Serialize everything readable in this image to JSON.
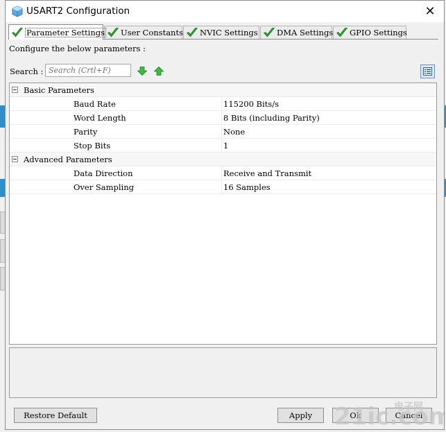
{
  "window": {
    "title": "USART2 Configuration",
    "close_glyph": "✕",
    "icon": "cube-icon"
  },
  "tabs": [
    {
      "label": "Parameter Settings",
      "icon": "green-check-icon",
      "active": true
    },
    {
      "label": "User Constants",
      "icon": "green-check-icon",
      "active": false
    },
    {
      "label": "NVIC Settings",
      "icon": "green-check-icon",
      "active": false
    },
    {
      "label": "DMA Settings",
      "icon": "green-check-icon",
      "active": false
    },
    {
      "label": "GPIO Settings",
      "icon": "green-check-icon",
      "active": false
    }
  ],
  "panel": {
    "description": "Configure the below parameters :",
    "search_label": "Search :",
    "search_placeholder": "Search (Crtl+F)",
    "down_arrow_icon": "green-down-arrow-icon",
    "up_arrow_icon": "green-up-arrow-icon",
    "view_icon": "list-view-icon"
  },
  "groups": [
    {
      "label": "Basic Parameters",
      "params": [
        {
          "name": "Baud Rate",
          "value": "115200 Bits/s"
        },
        {
          "name": "Word Length",
          "value": "8 Bits (including Parity)"
        },
        {
          "name": "Parity",
          "value": "None"
        },
        {
          "name": "Stop Bits",
          "value": "1"
        }
      ]
    },
    {
      "label": "Advanced Parameters",
      "params": [
        {
          "name": "Data Direction",
          "value": "Receive and Transmit"
        },
        {
          "name": "Over Sampling",
          "value": "16 Samples"
        }
      ]
    }
  ],
  "buttons": {
    "restore_default": "Restore Default",
    "apply": "Apply",
    "ok": "Ok",
    "cancel": "Cancel"
  },
  "watermark": {
    "text": "21ic.com",
    "chinese": "电子网",
    "color": "#b4b4b4"
  },
  "colors": {
    "check_green": "#2e9f2e",
    "background_accent": "#2d8ec9"
  }
}
